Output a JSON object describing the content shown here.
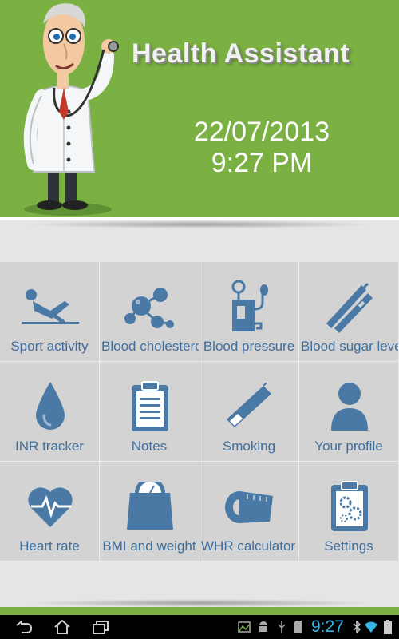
{
  "header": {
    "title": "Health Assistant",
    "date": "22/07/2013",
    "time": "9:27 PM"
  },
  "tiles": [
    {
      "label": "Sport activity",
      "icon": "sport-activity-icon"
    },
    {
      "label": "Blood cholesterol",
      "icon": "molecule-icon"
    },
    {
      "label": "Blood pressure",
      "icon": "blood-pressure-icon"
    },
    {
      "label": "Blood sugar level",
      "icon": "blood-sugar-strip-icon"
    },
    {
      "label": "INR tracker",
      "icon": "drop-icon"
    },
    {
      "label": "Notes",
      "icon": "clipboard-icon"
    },
    {
      "label": "Smoking",
      "icon": "cigarette-icon"
    },
    {
      "label": "Your profile",
      "icon": "person-icon"
    },
    {
      "label": "Heart rate",
      "icon": "heart-rate-icon"
    },
    {
      "label": "BMI and weight",
      "icon": "scale-icon"
    },
    {
      "label": "WHR calculator",
      "icon": "tape-measure-icon"
    },
    {
      "label": "Settings",
      "icon": "settings-clipboard-icon"
    }
  ],
  "statusbar": {
    "clock": "9:27"
  },
  "colors": {
    "header_green": "#7bb142",
    "tile_bg": "#d4d3d4",
    "icon_blue": "#4a79a6",
    "label_blue": "#3f6f9d",
    "clock_blue": "#33b5e5"
  }
}
